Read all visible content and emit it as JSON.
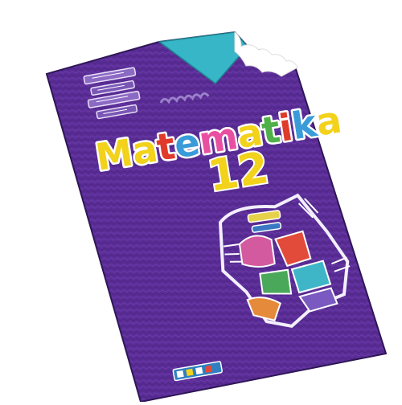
{
  "book": {
    "title": "Matematika",
    "grade": "12",
    "publisher_logo": "mozaik-logo"
  },
  "colors": {
    "cover": "#5a2d96",
    "cover_dark": "#3f1f70",
    "flap": "#36b6c7",
    "title_letters": [
      "#f2d21a",
      "#f2d21a",
      "#e03a2a",
      "#3a9bd9",
      "#e94fa0",
      "#f2d21a",
      "#4fb04a",
      "#e03a2a",
      "#3a9bd9",
      "#f2d21a"
    ],
    "grade": "#f2d21a",
    "logo": "#2f7fc1"
  },
  "icons": [
    "math-emblem-icon",
    "abstract-art-illustration",
    "torn-corner"
  ]
}
